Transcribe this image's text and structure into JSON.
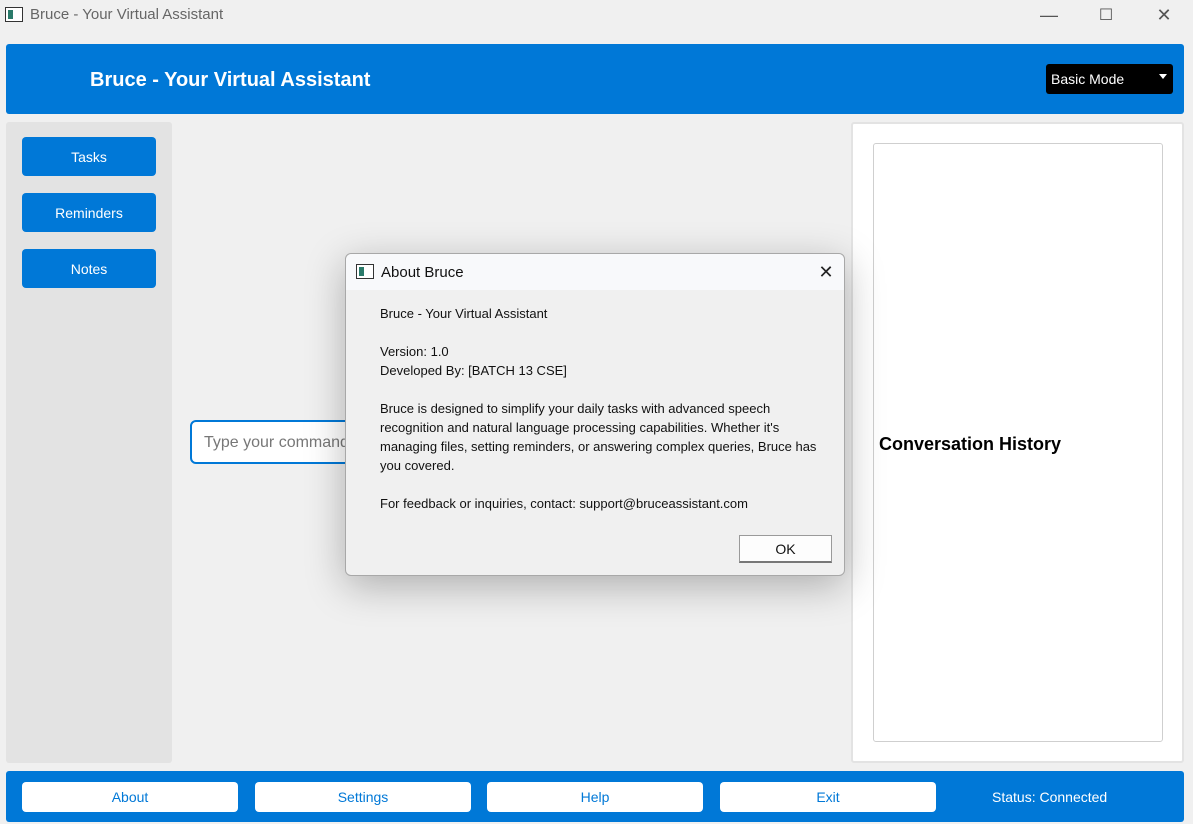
{
  "window": {
    "title": "Bruce - Your Virtual Assistant",
    "minimize": "—",
    "maximize": "☐",
    "close": "✕"
  },
  "header": {
    "title": "Bruce - Your Virtual Assistant",
    "mode_selected": "Basic Mode"
  },
  "sidebar": {
    "items": [
      {
        "label": "Tasks"
      },
      {
        "label": "Reminders"
      },
      {
        "label": "Notes"
      }
    ]
  },
  "command": {
    "placeholder": "Type your command"
  },
  "conversation": {
    "title": "Conversation History"
  },
  "bottom": {
    "buttons": [
      {
        "label": "About"
      },
      {
        "label": "Settings"
      },
      {
        "label": "Help"
      },
      {
        "label": "Exit"
      }
    ],
    "status": "Status: Connected"
  },
  "dialog": {
    "title": "About Bruce",
    "close": "✕",
    "heading": "Bruce - Your Virtual Assistant",
    "version": "Version: 1.0",
    "developed_by": "Developed By: [BATCH 13 CSE]",
    "description": "Bruce is designed to simplify your daily tasks with advanced speech recognition and natural language processing capabilities. Whether it's managing files, setting reminders, or answering complex queries, Bruce has you covered.",
    "contact": "For feedback or inquiries, contact: support@bruceassistant.com",
    "ok_label": "OK"
  },
  "colors": {
    "accent": "#0078d7",
    "sidebar_bg": "#e3e3e3",
    "mode_bg": "#000000"
  }
}
